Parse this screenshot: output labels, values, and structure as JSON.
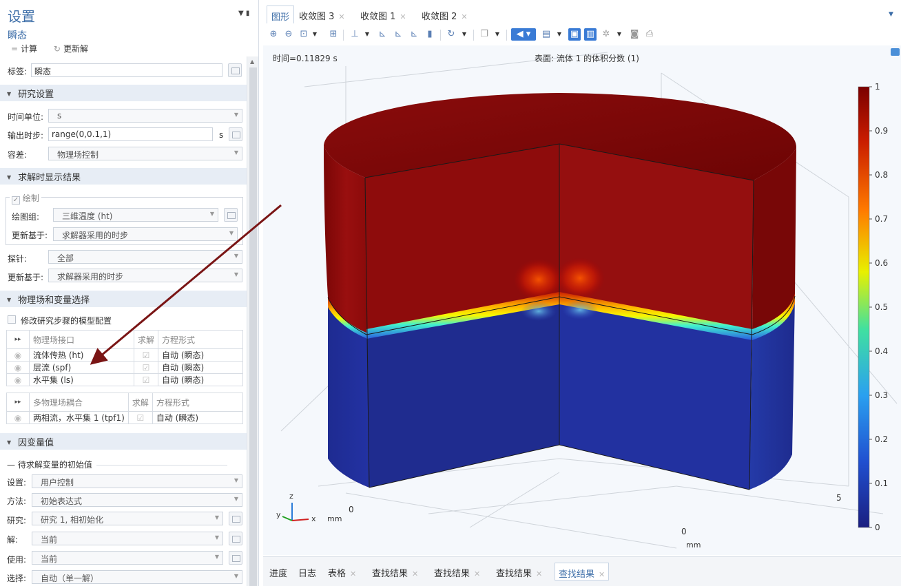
{
  "settings": {
    "title": "设置",
    "subtitle": "瞬态",
    "compute_label": "计算",
    "update_label": "更新解",
    "tag_label": "标签:",
    "tag_value": "瞬态",
    "sections": {
      "study": "研究设置",
      "display": "求解时显示结果",
      "physics": "物理场和变量选择",
      "dependent": "因变量值"
    },
    "time_unit_label": "时间单位:",
    "time_unit_value": "s",
    "output_times_label": "输出时步:",
    "output_times_value": "range(0,0.1,1)",
    "output_times_unit": "s",
    "tolerance_label": "容差:",
    "tolerance_value": "物理场控制",
    "plot_check_label": "绘制",
    "plot_group_label": "绘图组:",
    "plot_group_value": "三维温度 (ht)",
    "update_at_label": "更新基于:",
    "update_at_value": "求解器采用的时步",
    "probes_label": "探针:",
    "probes_value": "全部",
    "update_at2_label": "更新基于:",
    "update_at2_value": "求解器采用的时步",
    "modify_config_label": "修改研究步骤的模型配置",
    "physics_table": {
      "headers": [
        "物理场接口",
        "求解",
        "方程形式"
      ],
      "rows": [
        {
          "name": "流体传热 (ht)",
          "form": "自动 (瞬态)"
        },
        {
          "name": "层流 (spf)",
          "form": "自动 (瞬态)"
        },
        {
          "name": "水平集 (ls)",
          "form": "自动 (瞬态)"
        }
      ]
    },
    "multiphysics_table": {
      "headers": [
        "多物理场耦合",
        "求解",
        "方程形式"
      ],
      "rows": [
        {
          "name": "两相流，水平集 1 (tpf1)",
          "form": "自动 (瞬态)"
        }
      ]
    },
    "initial_values_label": "待求解变量的初始值",
    "iv_settings_label": "设置:",
    "iv_settings_value": "用户控制",
    "iv_method_label": "方法:",
    "iv_method_value": "初始表达式",
    "iv_study_label": "研究:",
    "iv_study_value": "研究 1, 相初始化",
    "iv_solution_label": "解:",
    "iv_solution_value": "当前",
    "iv_use_label": "使用:",
    "iv_use_value": "当前",
    "iv_selection_label": "选择:",
    "iv_selection_value": "自动（单一解）"
  },
  "graphics": {
    "tabs": [
      {
        "label": "图形",
        "active": true
      },
      {
        "label": "收敛图 3"
      },
      {
        "label": "收敛图 1"
      },
      {
        "label": "收敛图 2"
      }
    ],
    "time_label": "时间=0.11829 s",
    "surface_label": "表面: 流体 1 的体积分数 (1)",
    "colorbar_ticks": [
      "1",
      "0.9",
      "0.8",
      "0.7",
      "0.6",
      "0.5",
      "0.4",
      "0.3",
      "0.2",
      "0.1",
      "0"
    ],
    "axis_ticks": {
      "x0": "0",
      "x5": "5",
      "y0": "0"
    },
    "axis_unit_1": "mm",
    "axis_unit_2": "mm",
    "triad": {
      "z": "z",
      "y": "y",
      "x": "x"
    }
  },
  "bottom_tabs": [
    {
      "label": "进度"
    },
    {
      "label": "日志"
    },
    {
      "label": "表格"
    },
    {
      "label": "查找结果"
    },
    {
      "label": "查找结果"
    },
    {
      "label": "查找结果"
    },
    {
      "label": "查找结果",
      "active": true
    }
  ],
  "colors": {
    "accent": "#3d6ea8",
    "fluid_top": "#8e0b0b",
    "fluid_bottom": "#1c2a8a",
    "arrow": "#7a1515"
  }
}
